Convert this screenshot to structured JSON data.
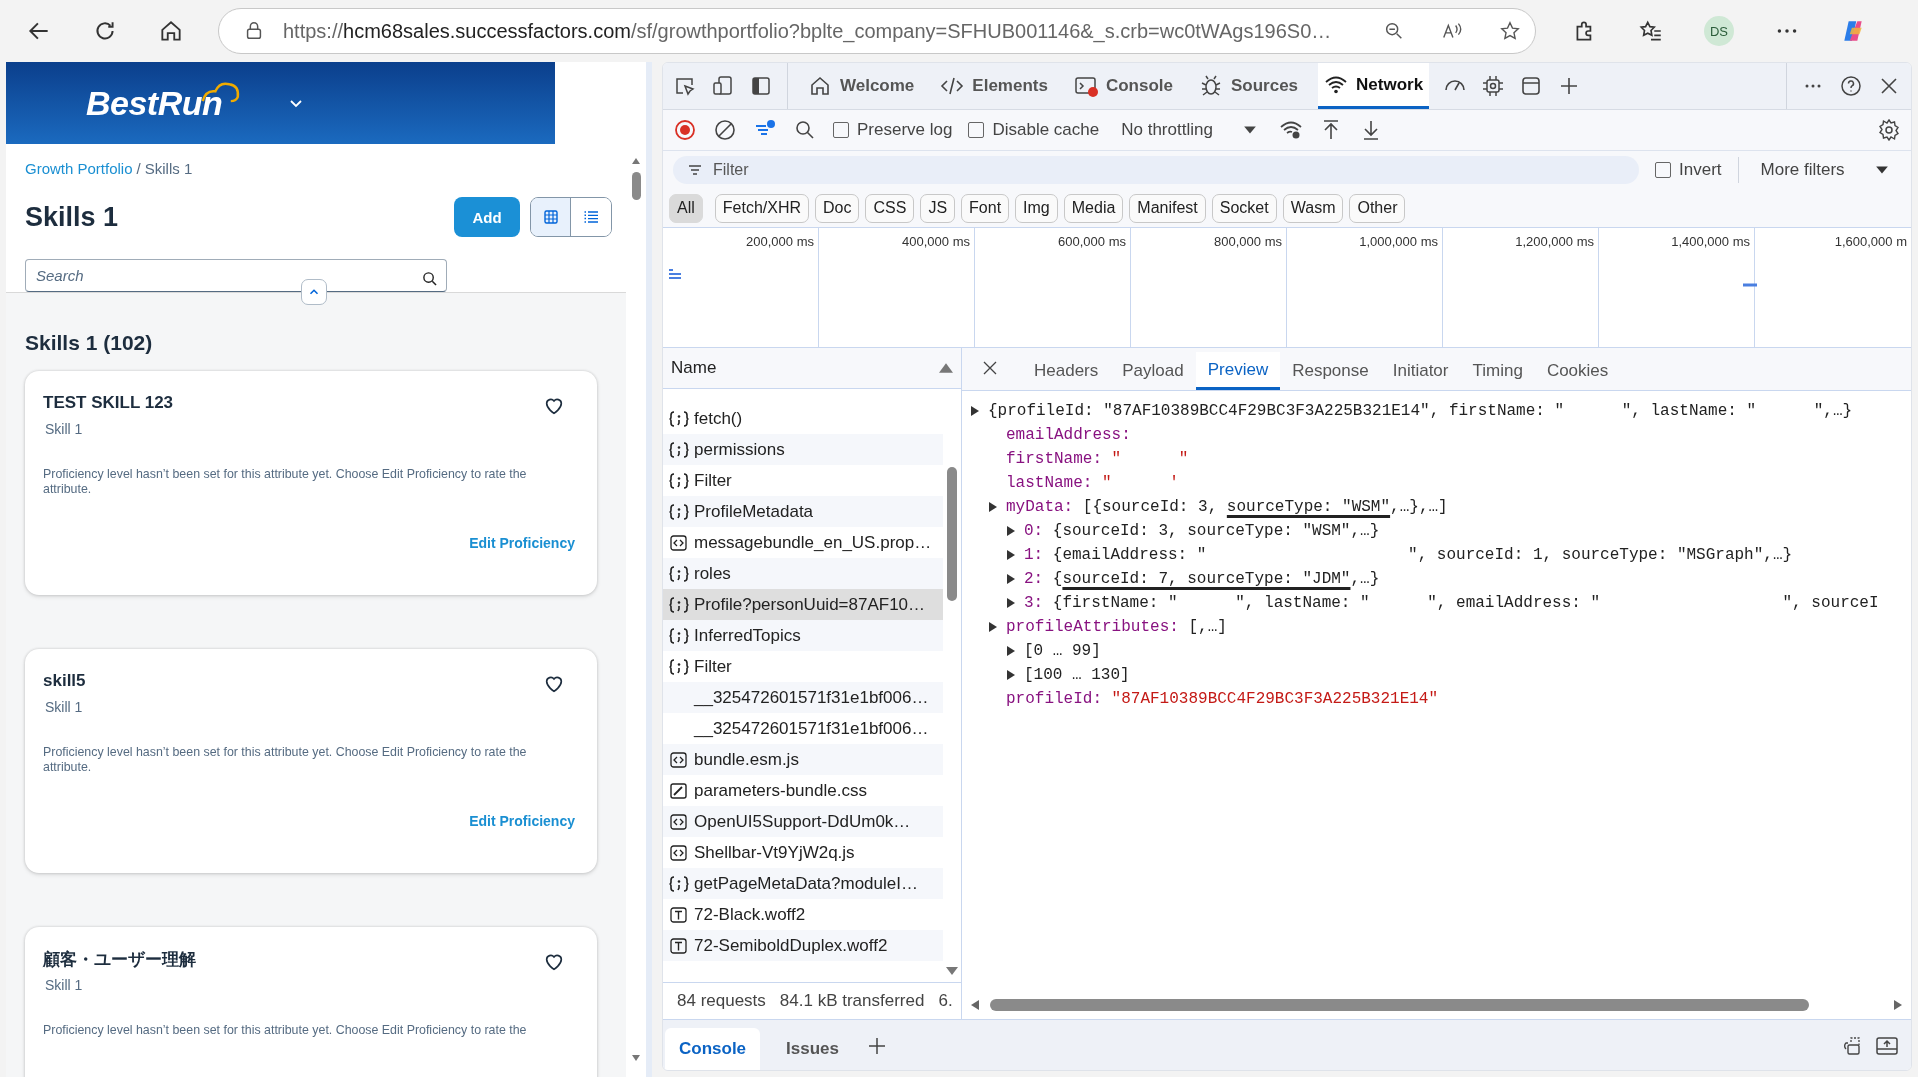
{
  "browser": {
    "url": {
      "scheme": "https://",
      "host": "hcm68sales.successfactors.com",
      "rest": "/sf/growthportfolio?bplte_company=SFHUB001146&_s.crb=wc0tWAgs196S0…"
    },
    "profile": "DS"
  },
  "app": {
    "logo": "BestRun",
    "breadcrumb": {
      "link": "Growth Portfolio",
      "separator": "/",
      "current": "Skills 1"
    },
    "title": "Skills 1",
    "add_button": "Add",
    "view_toggle": [
      {
        "kind": "grid",
        "selected": true
      },
      {
        "kind": "list",
        "selected": false
      }
    ],
    "search": {
      "placeholder": "Search"
    },
    "list_title": "Skills 1 (102)",
    "cards": [
      {
        "title": "TEST SKILL 123",
        "subtitle": "Skill 1",
        "description": "Proficiency level hasn’t been set for this attribute yet. Choose Edit Proficiency to rate the attribute.",
        "link": "Edit Proficiency"
      },
      {
        "title": "skill5",
        "subtitle": "Skill 1",
        "description": "Proficiency level hasn’t been set for this attribute yet. Choose Edit Proficiency to rate the attribute.",
        "link": "Edit Proficiency"
      },
      {
        "title": "顧客・ユーザー理解",
        "subtitle": "Skill 1",
        "description": "Proficiency level hasn’t been set for this attribute yet. Choose Edit Proficiency to rate the"
      }
    ]
  },
  "devtools": {
    "tabs": [
      {
        "label": "Welcome",
        "kind": "home",
        "selected": false
      },
      {
        "label": "Elements",
        "kind": "elements",
        "selected": false
      },
      {
        "label": "Console",
        "kind": "console",
        "selected": false
      },
      {
        "label": "Sources",
        "kind": "sources",
        "selected": false
      },
      {
        "label": "Network",
        "kind": "network",
        "selected": true
      }
    ],
    "toolbar": {
      "preserve_log": {
        "label": "Preserve log",
        "checked": false
      },
      "disable_cache": {
        "label": "Disable cache",
        "checked": false
      },
      "throttling": "No throttling"
    },
    "filter": {
      "placeholder": "Filter",
      "invert": {
        "label": "Invert",
        "checked": false
      },
      "more_filters": "More filters"
    },
    "type_filters": [
      {
        "label": "All",
        "selected": true
      },
      {
        "label": "Fetch/XHR",
        "selected": false
      },
      {
        "label": "Doc",
        "selected": false
      },
      {
        "label": "CSS",
        "selected": false
      },
      {
        "label": "JS",
        "selected": false
      },
      {
        "label": "Font",
        "selected": false
      },
      {
        "label": "Img",
        "selected": false
      },
      {
        "label": "Media",
        "selected": false
      },
      {
        "label": "Manifest",
        "selected": false
      },
      {
        "label": "Socket",
        "selected": false
      },
      {
        "label": "Wasm",
        "selected": false
      },
      {
        "label": "Other",
        "selected": false
      }
    ],
    "timeline": {
      "ticks": [
        "200,000 ms",
        "400,000 ms",
        "600,000 ms",
        "800,000 ms",
        "1,000,000 ms",
        "1,200,000 ms",
        "1,400,000 ms",
        "1,600,000 m"
      ]
    },
    "name_header": "Name",
    "requests": [
      {
        "name": "fetch()",
        "kind": "fetch",
        "selected": false
      },
      {
        "name": "permissions",
        "kind": "fetch",
        "selected": false
      },
      {
        "name": "Filter",
        "kind": "fetch",
        "selected": false
      },
      {
        "name": "ProfileMetadata",
        "kind": "fetch",
        "selected": false
      },
      {
        "name": "messagebundle_en_US.prop…",
        "kind": "script",
        "selected": false
      },
      {
        "name": "roles",
        "kind": "fetch",
        "selected": false
      },
      {
        "name": "Profile?personUuid=87AF10…",
        "kind": "fetch",
        "selected": true
      },
      {
        "name": "InferredTopics",
        "kind": "fetch",
        "selected": false
      },
      {
        "name": "Filter",
        "kind": "fetch",
        "selected": false
      },
      {
        "name": "__325472601571f31e1bf006…",
        "kind": "other",
        "selected": false
      },
      {
        "name": "__325472601571f31e1bf006…",
        "kind": "other",
        "selected": false
      },
      {
        "name": "bundle.esm.js",
        "kind": "script",
        "selected": false
      },
      {
        "name": "parameters-bundle.css",
        "kind": "css",
        "selected": false
      },
      {
        "name": "OpenUI5Support-DdUm0k…",
        "kind": "script",
        "selected": false
      },
      {
        "name": "Shellbar-Vt9YjW2q.js",
        "kind": "script",
        "selected": false
      },
      {
        "name": "getPageMetaData?moduleI…",
        "kind": "fetch",
        "selected": false
      },
      {
        "name": "72-Black.woff2",
        "kind": "font",
        "selected": false
      },
      {
        "name": "72-SemiboldDuplex.woff2",
        "kind": "font",
        "selected": false
      }
    ],
    "status": [
      "84 requests",
      "84.1 kB transferred",
      "6."
    ],
    "detail_tabs": [
      {
        "label": "Headers",
        "selected": false
      },
      {
        "label": "Payload",
        "selected": false
      },
      {
        "label": "Preview",
        "selected": true
      },
      {
        "label": "Response",
        "selected": false
      },
      {
        "label": "Initiator",
        "selected": false
      },
      {
        "label": "Timing",
        "selected": false
      },
      {
        "label": "Cookies",
        "selected": false
      }
    ],
    "preview": {
      "expandable": true,
      "kind": "summary",
      "value": [
        {
          "text": "{profileId: \"87AF10389BCC4F29BC3F3A225B321E14\", firstName: \"      \", lastName: \"      \",…}"
        }
      ],
      "children": [
        {
          "key": "emailAddress:",
          "expandable": false
        },
        {
          "key": "firstName:",
          "expandable": false,
          "kind": "string",
          "value": [
            {
              "text": "\"      \""
            }
          ]
        },
        {
          "key": "lastName:",
          "expandable": false,
          "kind": "string",
          "value": [
            {
              "text": "\"      '"
            }
          ]
        },
        {
          "key": "myData:",
          "expandable": true,
          "kind": "summary",
          "value": [
            {
              "text": "[{sourceId: 3, "
            },
            {
              "text": "sourceType: \"WSM\"",
              "underlined": true
            },
            {
              "text": ",…},…]"
            }
          ],
          "children": [
            {
              "key": "0:",
              "expandable": true,
              "kind": "summary",
              "value": [
                {
                  "text": "{sourceId: 3, sourceType: \"WSM\",…}"
                }
              ]
            },
            {
              "key": "1:",
              "expandable": true,
              "kind": "summary",
              "value": [
                {
                  "text": "{emailAddress: \"                     \", sourceId: 1, sourceType: \"MSGraph\",…}"
                }
              ]
            },
            {
              "key": "2:",
              "expandable": true,
              "kind": "summary",
              "value": [
                {
                  "text": "{"
                },
                {
                  "text": "sourceId: 7, sourceType: \"JDM\"",
                  "underlined": true
                },
                {
                  "text": ",…}"
                }
              ]
            },
            {
              "key": "3:",
              "expandable": true,
              "kind": "summary",
              "value": [
                {
                  "text": "{firstName: \"      \", lastName: \"      \", emailAddress: \"                   \", sourceI"
                }
              ]
            }
          ]
        },
        {
          "key": "profileAttributes:",
          "expandable": true,
          "kind": "summary",
          "value": [
            {
              "text": "[,…]"
            }
          ],
          "children": [
            {
              "expandable": true,
              "kind": "summary",
              "value": [
                {
                  "text": "[0 … 99]"
                }
              ]
            },
            {
              "expandable": true,
              "kind": "summary",
              "value": [
                {
                  "text": "[100 … 130]"
                }
              ]
            }
          ]
        },
        {
          "key": "profileId:",
          "expandable": false,
          "kind": "string",
          "value": [
            {
              "text": "\"87AF10389BCC4F29BC3F3A225B321E14\""
            }
          ]
        }
      ]
    },
    "drawer_tabs": [
      {
        "label": "Console",
        "selected": true
      },
      {
        "label": "Issues",
        "selected": false
      }
    ]
  }
}
